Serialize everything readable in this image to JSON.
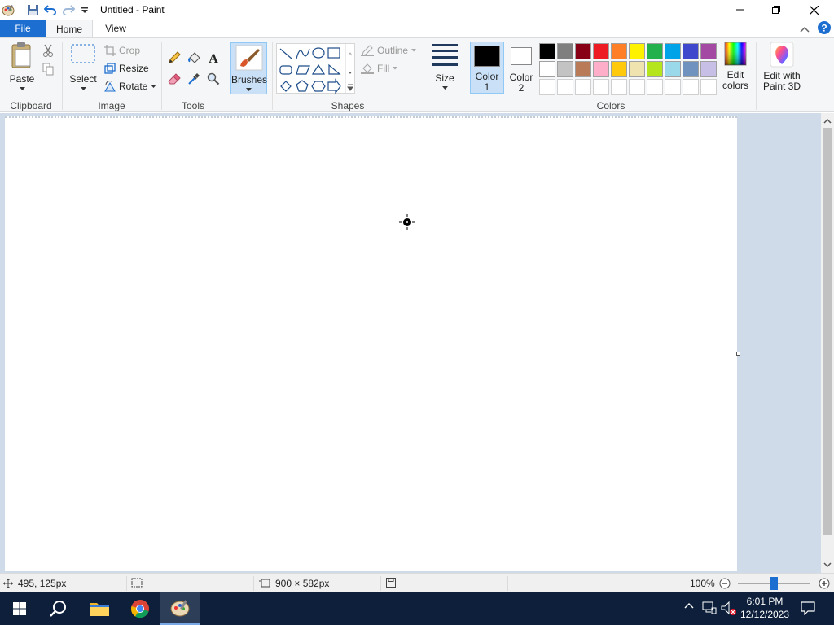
{
  "window": {
    "title": "Untitled - Paint"
  },
  "tabs": {
    "file": "File",
    "home": "Home",
    "view": "View"
  },
  "ribbon": {
    "clipboard": {
      "paste": "Paste",
      "group_label": "Clipboard"
    },
    "image": {
      "select": "Select",
      "crop": "Crop",
      "resize": "Resize",
      "rotate": "Rotate",
      "group_label": "Image"
    },
    "tools": {
      "group_label": "Tools"
    },
    "brushes": {
      "label": "Brushes"
    },
    "shapes": {
      "outline": "Outline",
      "fill": "Fill",
      "group_label": "Shapes"
    },
    "size": {
      "label": "Size"
    },
    "colors": {
      "color1_label": "Color",
      "color1_num": "1",
      "color2_label": "Color",
      "color2_num": "2",
      "edit_colors_line1": "Edit",
      "edit_colors_line2": "colors",
      "group_label": "Colors",
      "color1_value": "#000000",
      "color2_value": "#ffffff",
      "palette": [
        "#000000",
        "#7f7f7f",
        "#880015",
        "#ed1c24",
        "#ff7f27",
        "#fff200",
        "#22b14c",
        "#00a2e8",
        "#3f48cc",
        "#a349a4",
        "#ffffff",
        "#c3c3c3",
        "#b97a57",
        "#ffaec9",
        "#ffc90e",
        "#efe4b0",
        "#b5e61d",
        "#99d9ea",
        "#7092be",
        "#c8bfe7",
        "#ffffff",
        "#ffffff",
        "#ffffff",
        "#ffffff",
        "#ffffff",
        "#ffffff",
        "#ffffff",
        "#ffffff",
        "#ffffff",
        "#ffffff"
      ]
    },
    "paint3d": {
      "line1": "Edit with",
      "line2": "Paint 3D"
    }
  },
  "statusbar": {
    "cursor_position": "495, 125px",
    "canvas_size": "900 × 582px",
    "zoom": "100%"
  },
  "taskbar": {
    "time": "6:01 PM",
    "date": "12/12/2023"
  },
  "accent_color": "#1c6ed0"
}
